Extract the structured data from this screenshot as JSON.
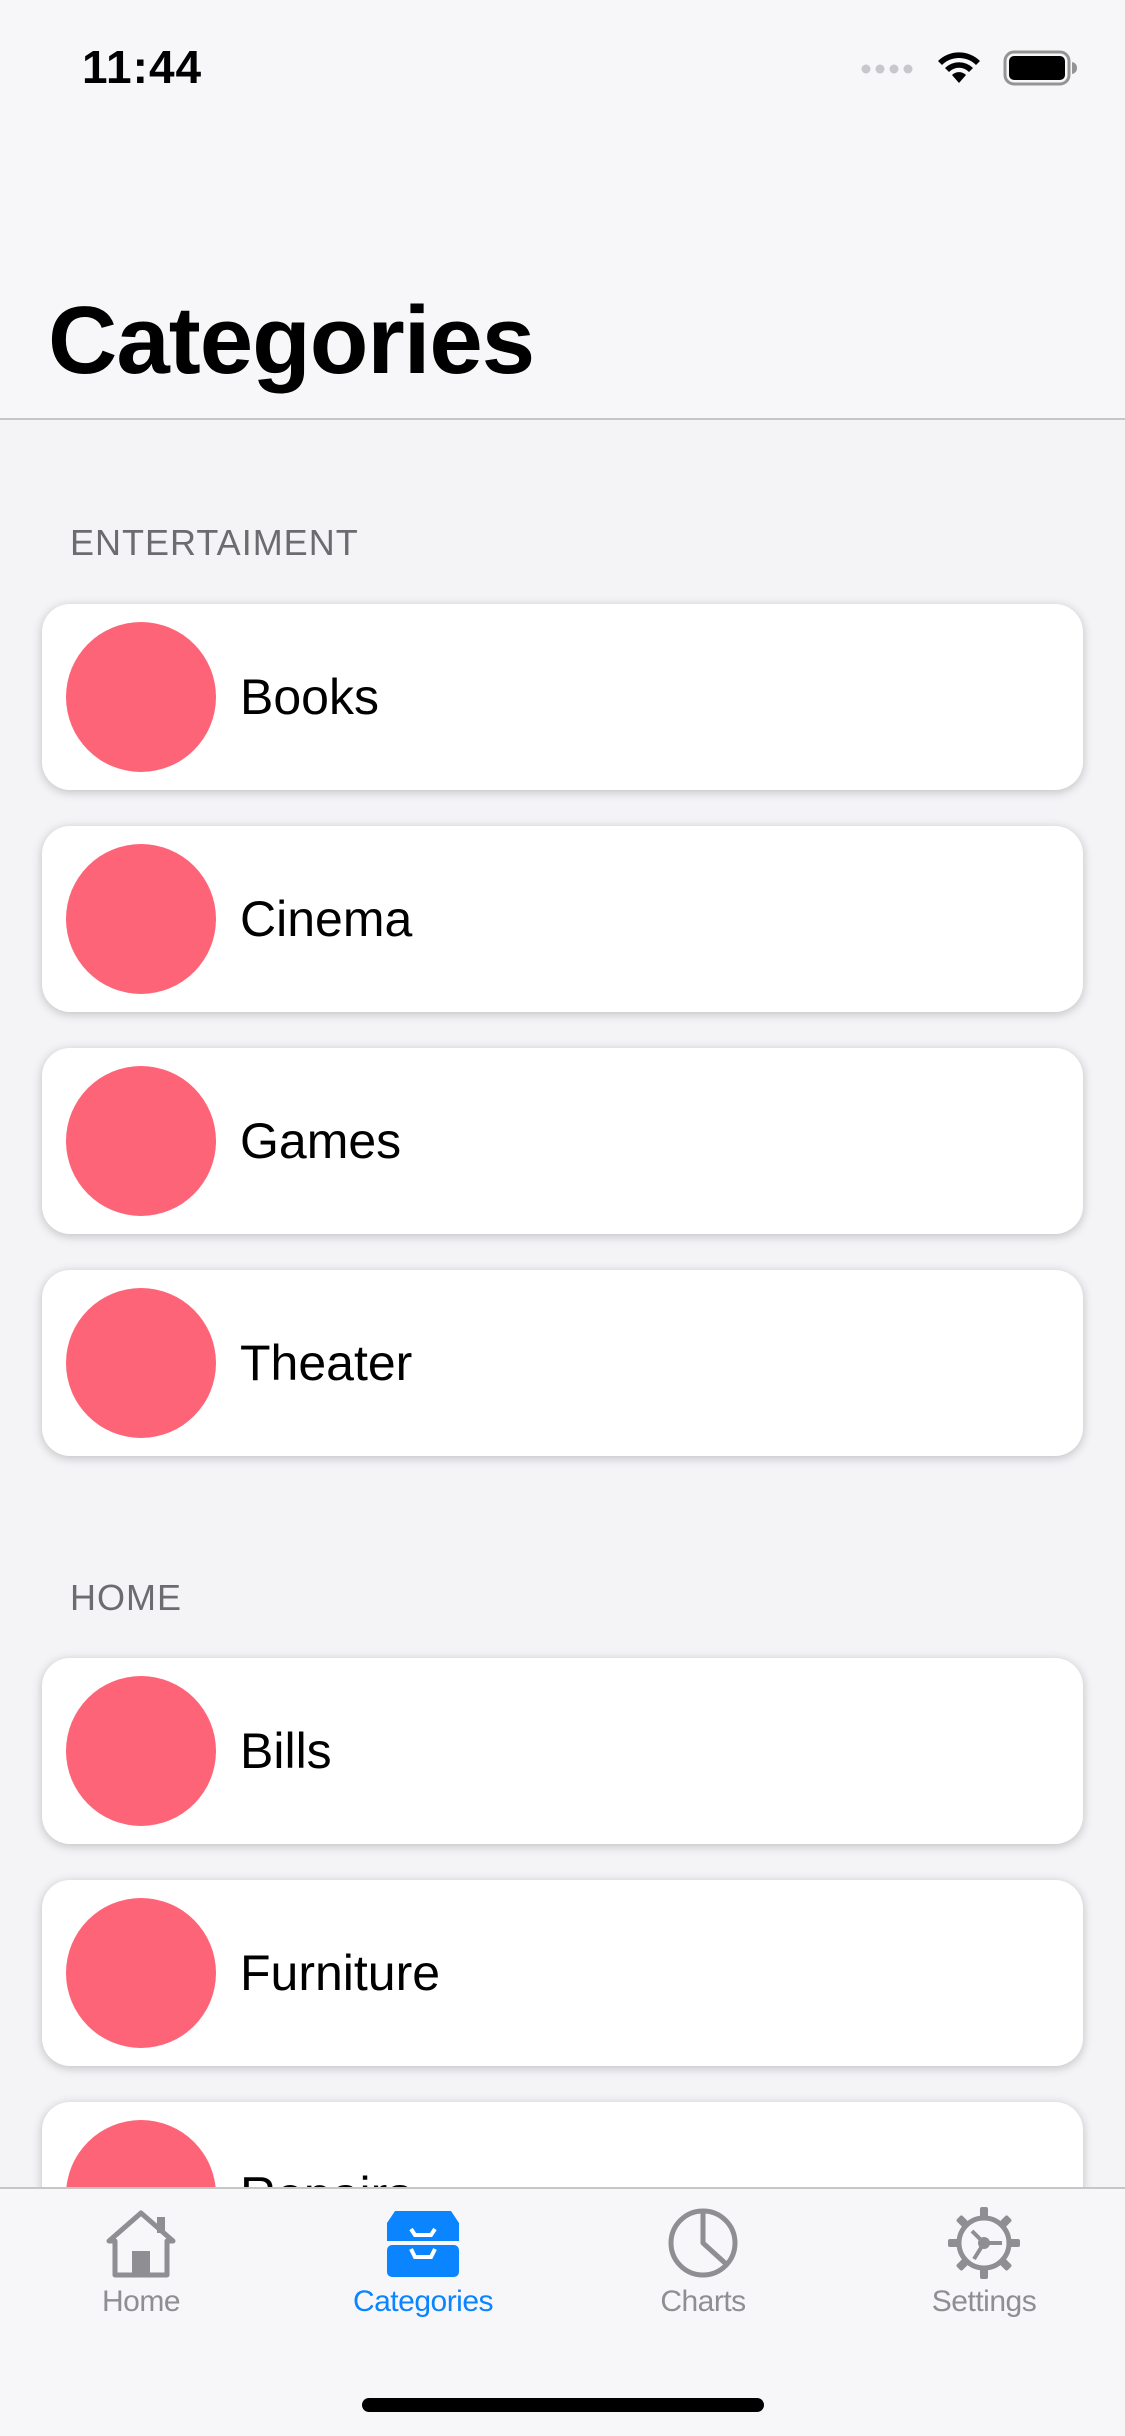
{
  "status_bar": {
    "time": "11:44",
    "icons": [
      "signal-dots-icon",
      "wifi-icon",
      "battery-icon"
    ]
  },
  "header": {
    "title": "Categories"
  },
  "sections": [
    {
      "title": "ENTERTAIMENT",
      "items": [
        {
          "label": "Books",
          "color": "#fe6478"
        },
        {
          "label": "Cinema",
          "color": "#fe6478"
        },
        {
          "label": "Games",
          "color": "#fe6478"
        },
        {
          "label": "Theater",
          "color": "#fe6478"
        }
      ]
    },
    {
      "title": "HOME",
      "items": [
        {
          "label": "Bills",
          "color": "#fe6478"
        },
        {
          "label": "Furniture",
          "color": "#fe6478"
        },
        {
          "label": "Repairs",
          "color": "#fe6478"
        }
      ]
    }
  ],
  "tab_bar": {
    "tabs": [
      {
        "label": "Home",
        "icon": "house-icon",
        "active": false
      },
      {
        "label": "Categories",
        "icon": "tray-icon",
        "active": true
      },
      {
        "label": "Charts",
        "icon": "pie-chart-icon",
        "active": false
      },
      {
        "label": "Settings",
        "icon": "gear-icon",
        "active": false
      }
    ]
  },
  "colors": {
    "accent": "#0a84ff",
    "category_dot": "#fe6478",
    "inactive_tab": "#8e8e93"
  }
}
